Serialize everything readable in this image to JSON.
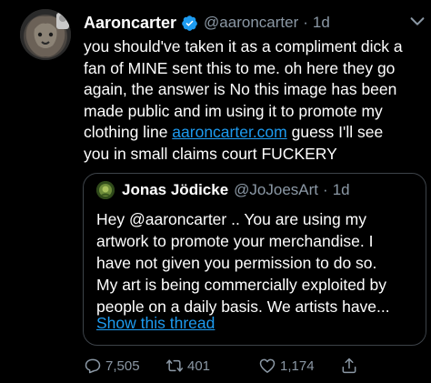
{
  "tweet": {
    "author_name": "Aaroncarter",
    "author_handle": "@aaroncarter",
    "separator": "·",
    "time": "1d",
    "lines": [
      "you should've taken it as a compliment dick a",
      "fan of MINE sent this to me. oh here they go",
      "again, the answer is No this image has been",
      "made public and im using it to promote my"
    ],
    "line5_prefix": "clothing line ",
    "link": "aaroncarter.com",
    "line5_suffix": " guess I'll see",
    "line6": "you in small claims court FUCKERY"
  },
  "quote": {
    "author_name": "Jonas Jödicke",
    "author_handle": "@JoJoesArt",
    "separator": "·",
    "time": "1d",
    "lines": [
      "Hey @aaroncarter .. You are using my",
      "artwork to promote your merchandise. I",
      "have not given you permission to do so.",
      "My art is being commercially exploited by",
      "people on a daily basis. We artists have..."
    ],
    "show_thread": "Show this thread"
  },
  "actions": {
    "replies": "7,505",
    "retweets": "401",
    "likes": "1,174"
  },
  "colors": {
    "background": "#000000",
    "text": "#ffffff",
    "secondary": "#8b98a5",
    "link": "#1d9bf0",
    "verified": "#1d9bf0",
    "border": "#3d4349"
  },
  "icons": [
    "verified-badge-icon",
    "chevron-down-icon",
    "reply-icon",
    "retweet-icon",
    "like-icon",
    "share-icon"
  ]
}
